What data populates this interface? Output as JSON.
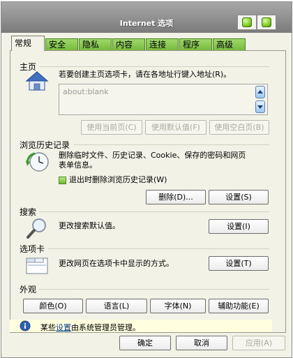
{
  "window": {
    "title": "Internet 选项"
  },
  "tabs": [
    {
      "label": "常规",
      "active": true
    },
    {
      "label": "安全"
    },
    {
      "label": "隐私"
    },
    {
      "label": "内容"
    },
    {
      "label": "连接"
    },
    {
      "label": "程序"
    },
    {
      "label": "高级"
    }
  ],
  "home": {
    "section": "主页",
    "description": "若要创建主页选项卡，请在各地址行键入地址(R)。",
    "address": "about:blank",
    "buttons": {
      "current": "使用当前页(C)",
      "default": "使用默认值(F)",
      "blank": "使用空白页(B)"
    }
  },
  "history": {
    "section": "浏览历史记录",
    "description_line1": "删除临时文件、历史记录、Cookie、保存的密码和网页",
    "description_line2": "表单信息。",
    "checkbox_label": "退出时删除浏览历史记录(W)",
    "checkbox_checked": true,
    "buttons": {
      "delete": "删除(D)...",
      "settings": "设置(S)"
    }
  },
  "search": {
    "section": "搜索",
    "description": "更改搜索默认值。",
    "buttons": {
      "settings": "设置(I)"
    }
  },
  "tabs_section": {
    "section": "选项卡",
    "description": "更改网页在选项卡中显示的方式。",
    "buttons": {
      "settings": "设置(T)"
    }
  },
  "appearance": {
    "section": "外观",
    "buttons": {
      "colors": "颜色(O)",
      "languages": "语言(L)",
      "fonts": "字体(N)",
      "accessibility": "辅助功能(E)"
    }
  },
  "info": {
    "prefix": "某些",
    "link": "设置",
    "suffix": "由系统管理员管理。"
  },
  "footer": {
    "ok": "确定",
    "cancel": "取消",
    "apply": "应用(A)"
  },
  "colors": {
    "tab_green": "#74b83a",
    "titlebar": "#8d8d8d",
    "dialog_bg": "#f2f2e6",
    "info_bg": "#ffffe0"
  }
}
